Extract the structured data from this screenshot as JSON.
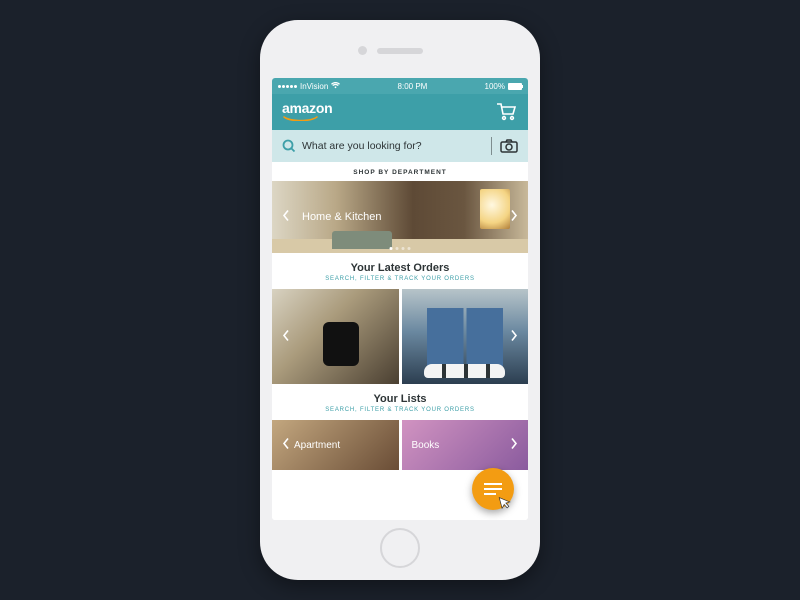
{
  "status_bar": {
    "carrier": "InVision",
    "time": "8:00 PM",
    "battery": "100%"
  },
  "header": {
    "logo_text": "amazon"
  },
  "search": {
    "placeholder": "What are you looking for?"
  },
  "departments": {
    "header": "SHOP BY DEPARTMENT",
    "current": "Home & Kitchen"
  },
  "orders": {
    "title": "Your Latest Orders",
    "subtitle": "SEARCH, FILTER & TRACK YOUR ORDERS"
  },
  "lists": {
    "title": "Your Lists",
    "subtitle": "SEARCH, FILTER & TRACK YOUR ORDERS",
    "items": [
      "Apartment",
      "Books"
    ]
  }
}
